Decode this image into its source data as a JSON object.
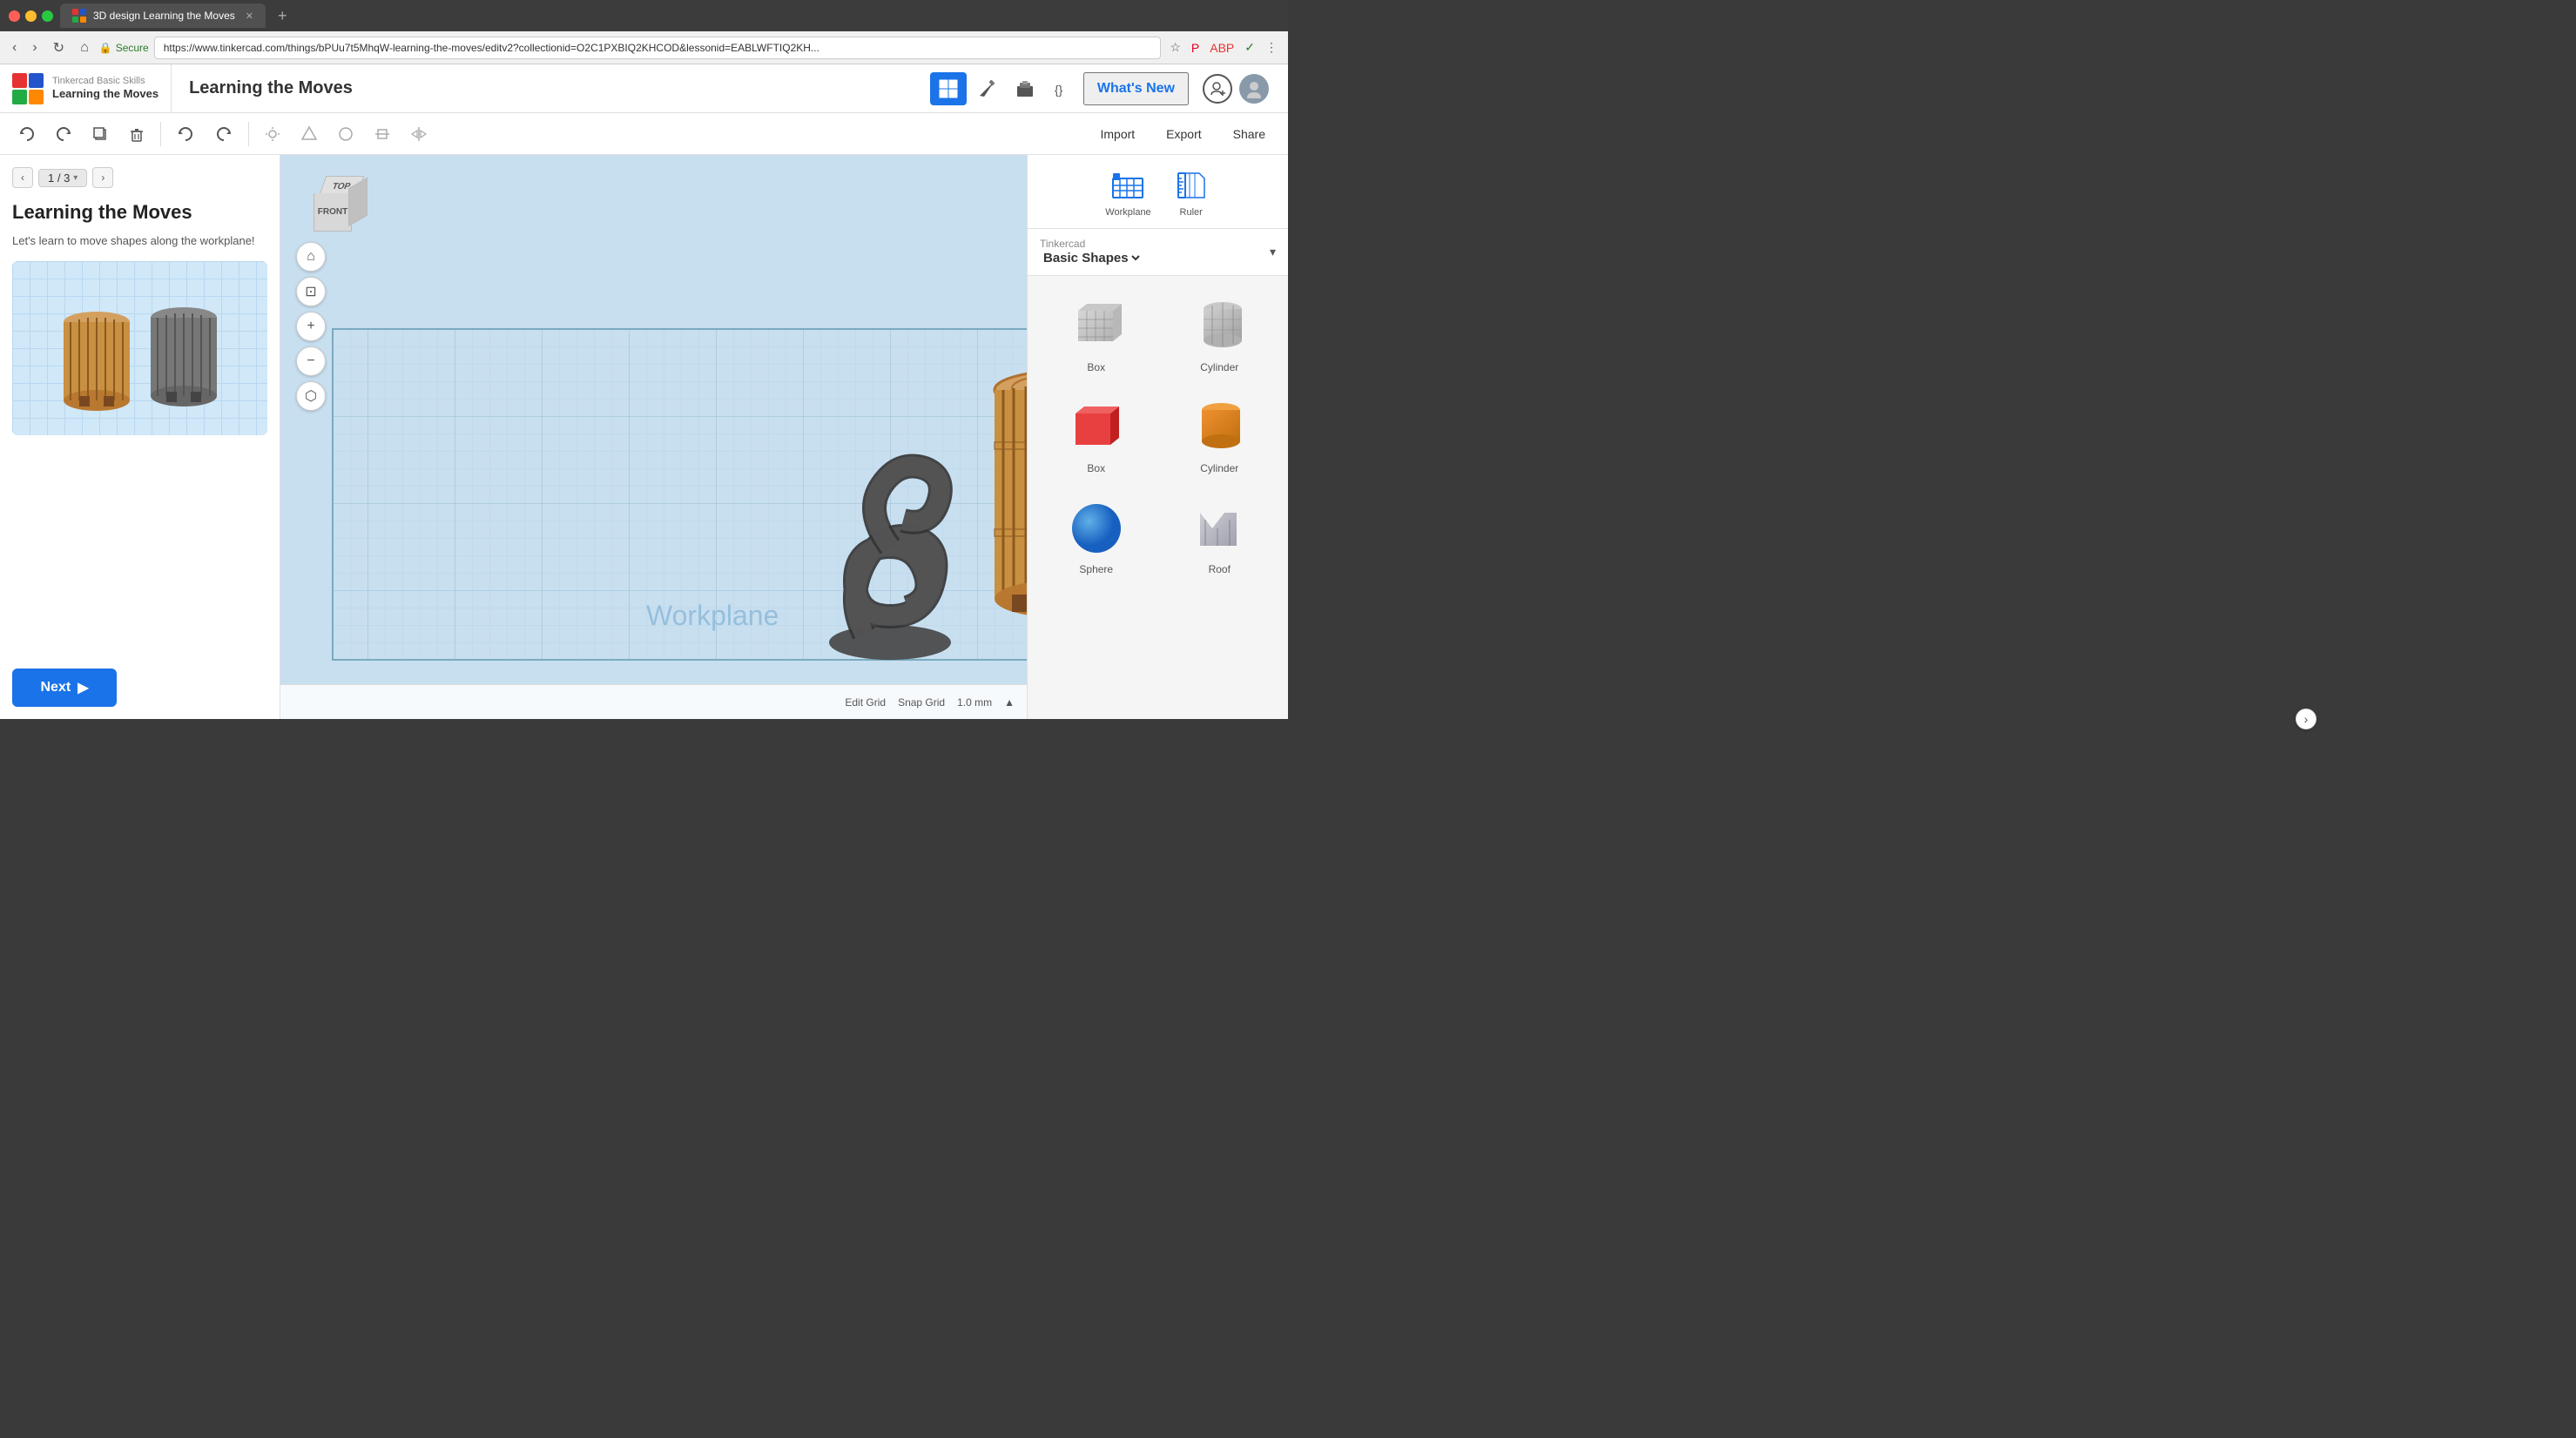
{
  "browser": {
    "tab_title": "3D design Learning the Moves",
    "url": "https://www.tinkercad.com/things/bPUu7t5MhqW-learning-the-moves/editv2?collectionid=O2C1PXBIQ2KHCOD&lessonid=EABLWFTIQ2KH...",
    "secure_label": "Secure",
    "new_tab_icon": "+"
  },
  "app": {
    "title": "Learning the Moves",
    "breadcrumb_main": "Tinkercad Basic Skills",
    "breadcrumb_sub": "Learning the Moves",
    "whats_new": "What's New",
    "tools": {
      "grid_icon": "⊞",
      "hammer_icon": "🔨",
      "blocks_icon": "⬛",
      "code_icon": "{}"
    }
  },
  "toolbar": {
    "import_label": "Import",
    "export_label": "Export",
    "share_label": "Share"
  },
  "left_panel": {
    "lesson_counter": "1 / 3",
    "lesson_title": "Learning the Moves",
    "lesson_desc": "Let's learn to move shapes along the workplane!",
    "next_btn": "Next"
  },
  "viewport": {
    "workplane_label": "Workplane",
    "view_cube": {
      "top_label": "TOP",
      "front_label": "FRONT"
    },
    "bottom_bar": {
      "edit_grid_label": "Edit Grid",
      "snap_grid_label": "Snap Grid",
      "snap_grid_value": "1.0 mm"
    }
  },
  "right_panel": {
    "workplane_label": "Workplane",
    "ruler_label": "Ruler",
    "shapes_brand": "Tinkercad",
    "shapes_category": "Basic Shapes",
    "shapes": [
      {
        "label": "Box",
        "color": "gray",
        "type": "box-wireframe"
      },
      {
        "label": "Cylinder",
        "color": "gray",
        "type": "cylinder-wireframe"
      },
      {
        "label": "Box",
        "color": "red",
        "type": "box-solid"
      },
      {
        "label": "Cylinder",
        "color": "orange",
        "type": "cylinder-solid"
      },
      {
        "label": "Sphere",
        "color": "blue",
        "type": "sphere-solid"
      },
      {
        "label": "Roof",
        "color": "gray",
        "type": "roof-wireframe"
      }
    ]
  }
}
